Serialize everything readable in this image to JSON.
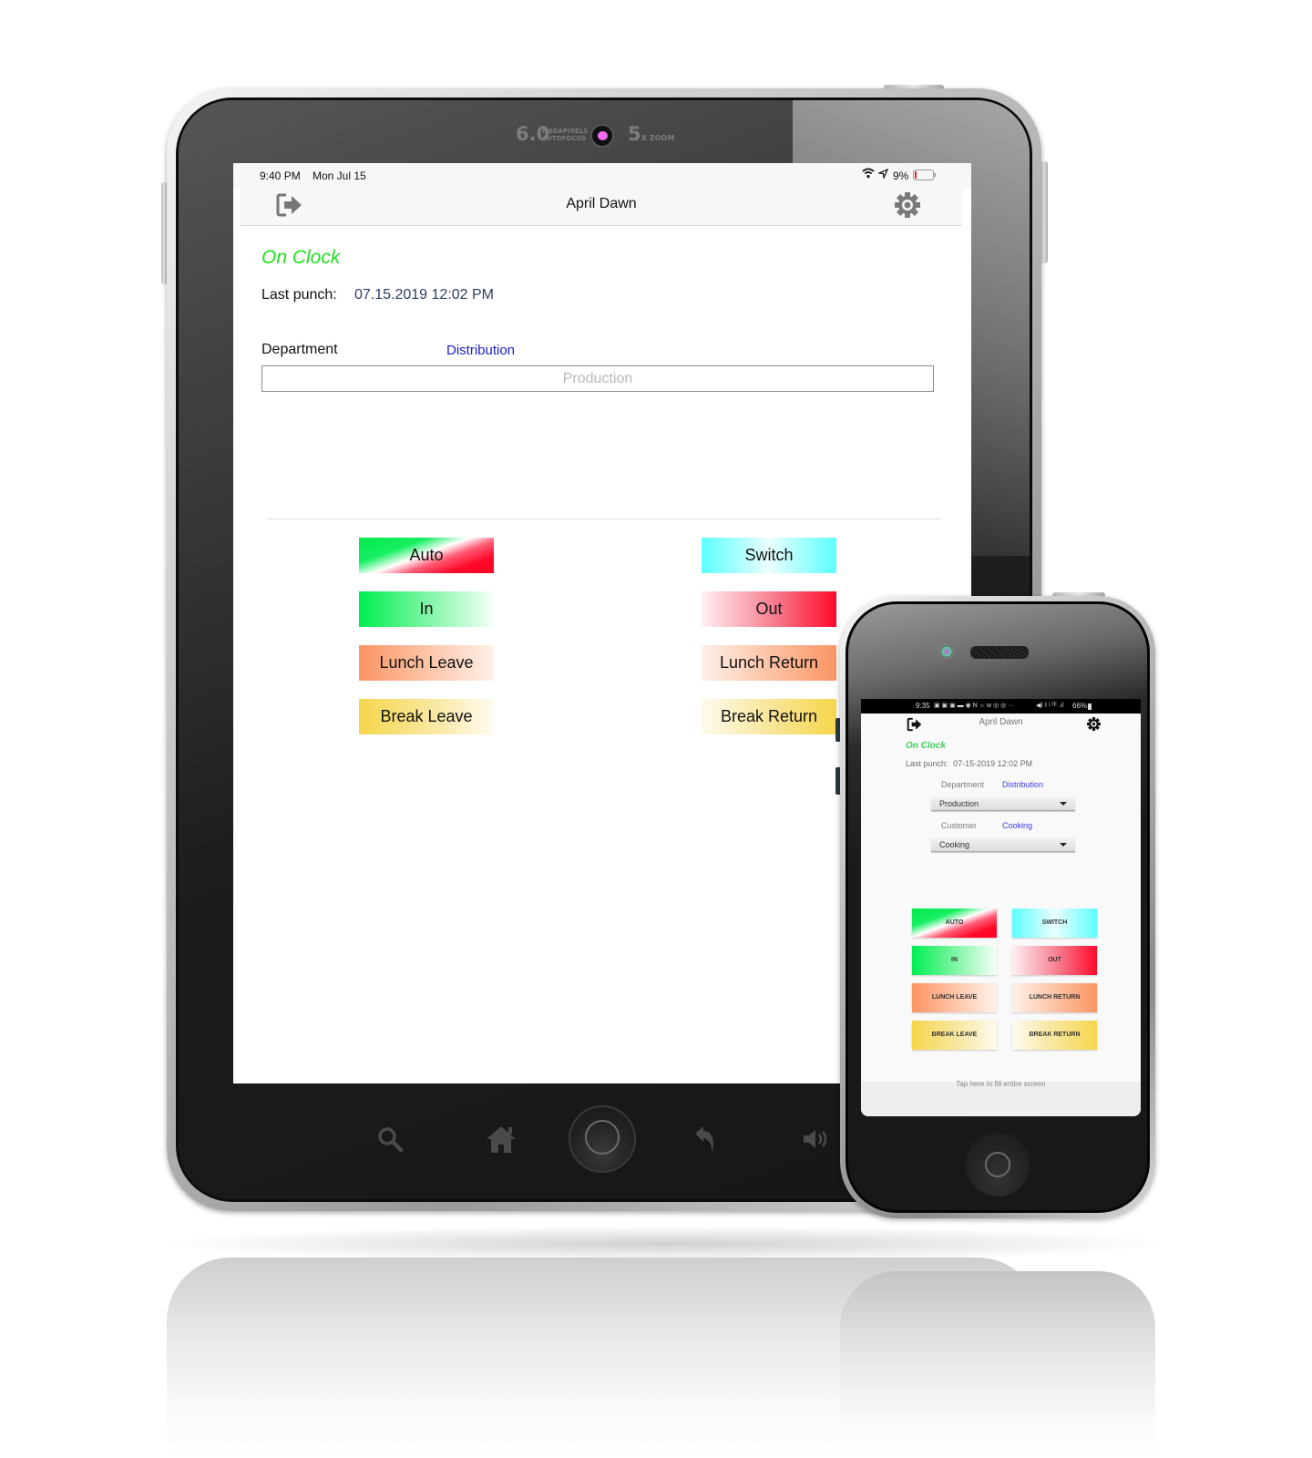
{
  "tablet": {
    "camera": {
      "megapixels": "6.0",
      "mp_line1": "MEGAPIXELS",
      "mp_line2": "AUTOFOCUS",
      "zoom_number": "5",
      "zoom_label": "X ZOOM"
    },
    "status_bar": {
      "time": "9:40 PM",
      "date": "Mon Jul 15",
      "battery_percent": "9%",
      "battery_level": 0.09,
      "icons": [
        "wifi-icon",
        "location-arrow-icon",
        "battery-icon"
      ]
    },
    "nav": {
      "title": "April Dawn",
      "left_icon": "logout-icon",
      "right_icon": "gear-icon"
    },
    "status": {
      "text": "On Clock",
      "color": "#1fe01f"
    },
    "last_punch": {
      "label": "Last punch:",
      "value": "07.15.2019 12:02 PM"
    },
    "department": {
      "label": "Department",
      "value": "Distribution",
      "field_value": "Production"
    },
    "buttons": [
      {
        "label": "Auto"
      },
      {
        "label": "Switch"
      },
      {
        "label": "In"
      },
      {
        "label": "Out"
      },
      {
        "label": "Lunch Leave"
      },
      {
        "label": "Lunch Return"
      },
      {
        "label": "Break Leave"
      },
      {
        "label": "Break Return"
      }
    ],
    "hardware_buttons": [
      "search-icon",
      "home-icon",
      "home-button",
      "back-icon",
      "volume-icon"
    ]
  },
  "phone": {
    "status_bar": {
      "time": "9:35",
      "notification_icons": "▣ ▣ ▣ ▬ ◉ N ☼ ᴡ ◎ ◎ ···",
      "signal_text": "◀ǀ ⌇ ᴸᵀᴱ .ıl",
      "battery_percent": "66%"
    },
    "nav": {
      "title": "April Dawn",
      "left_icon": "logout-icon",
      "right_icon": "gear-icon"
    },
    "status": {
      "text": "On Clock",
      "color": "#3fcf5a"
    },
    "last_punch": {
      "label": "Last punch:",
      "value": "07-15-2019 12:02 PM"
    },
    "department": {
      "label": "Department",
      "value": "Distribution",
      "select_value": "Production"
    },
    "customer": {
      "label": "Customer",
      "value": "Cooking",
      "select_value": "Cooking"
    },
    "buttons": [
      {
        "label": "AUTO"
      },
      {
        "label": "SWITCH"
      },
      {
        "label": "IN"
      },
      {
        "label": "OUT"
      },
      {
        "label": "LUNCH LEAVE"
      },
      {
        "label": "LUNCH RETURN"
      },
      {
        "label": "BREAK LEAVE"
      },
      {
        "label": "BREAK RETURN"
      }
    ],
    "footer_text": "Tap here to fill entire screen"
  },
  "colors": {
    "distribution_link": "#1d1dc8",
    "last_punch_value": "#2c3e66",
    "field_placeholder": "#b8b8b8"
  }
}
